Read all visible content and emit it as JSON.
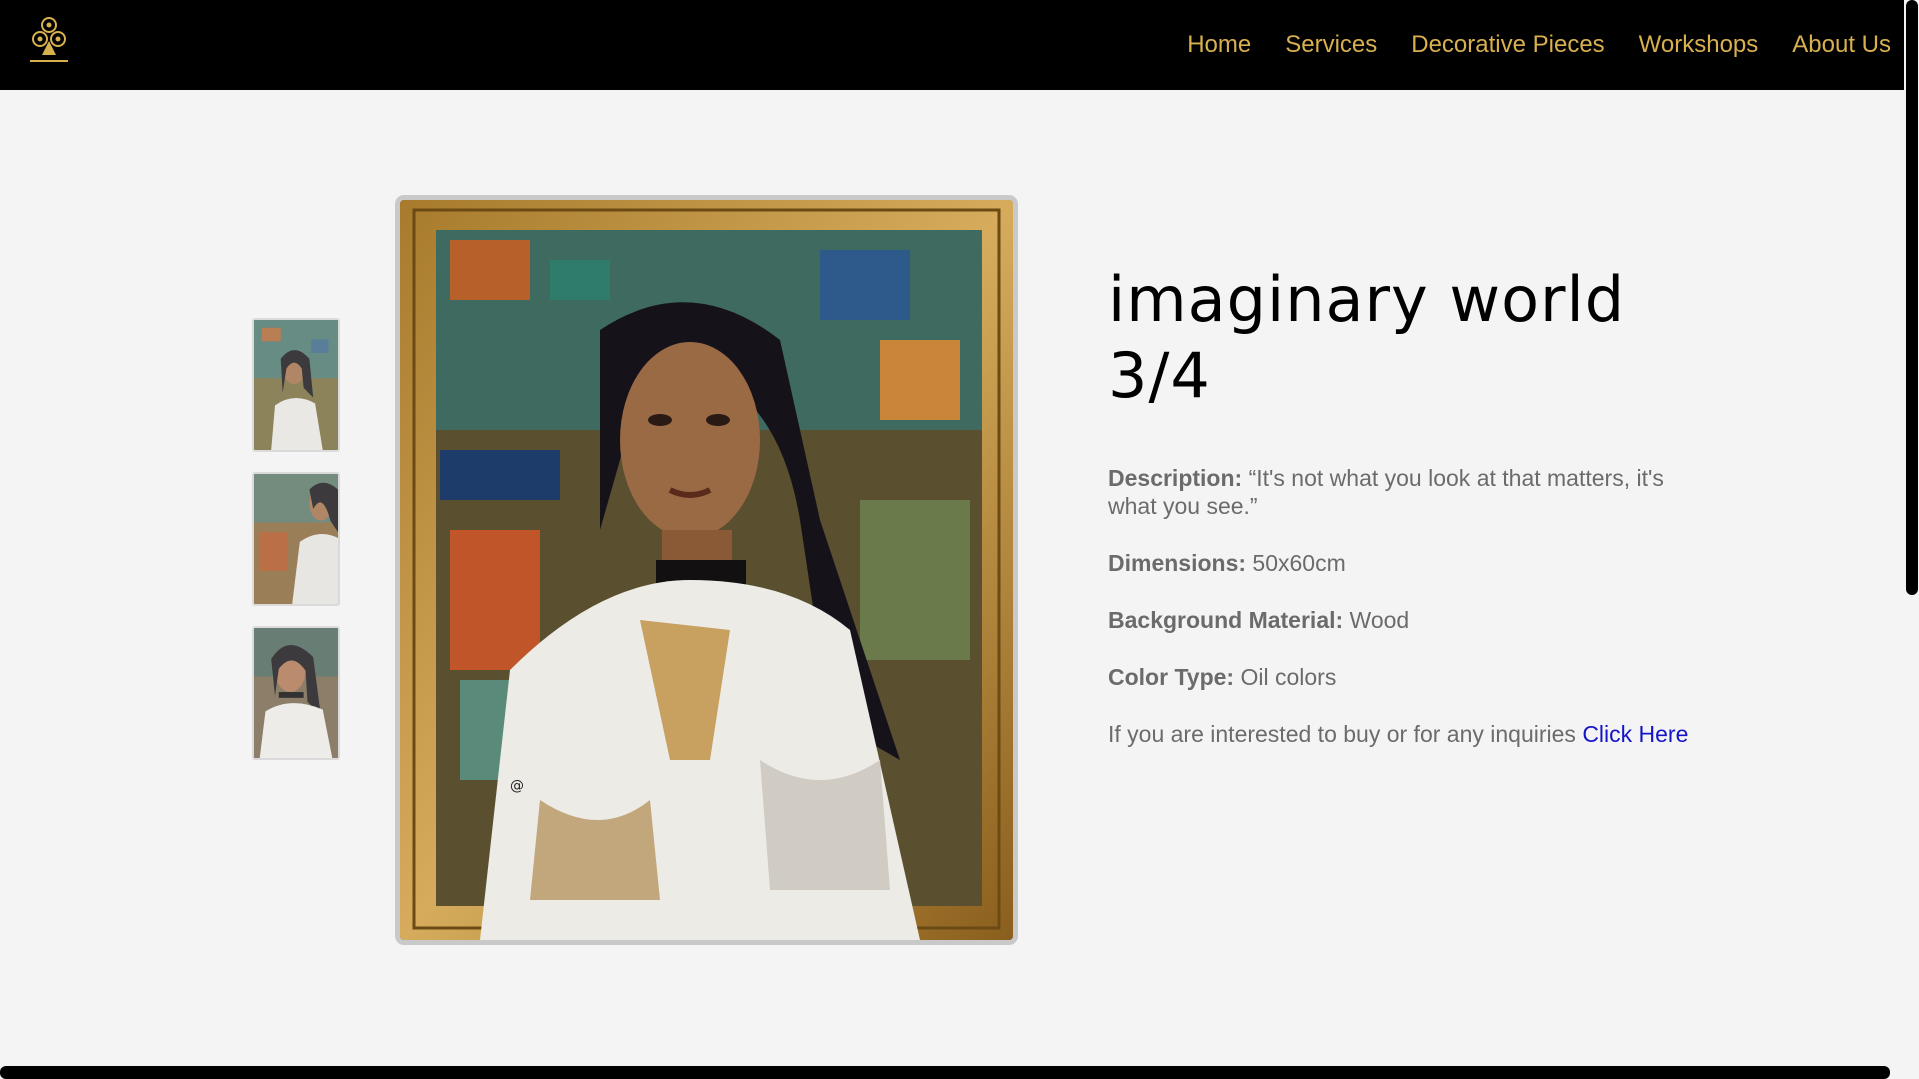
{
  "nav": {
    "logo_alt": "logo",
    "links": [
      "Home",
      "Services",
      "Decorative Pieces",
      "Workshops",
      "About Us"
    ]
  },
  "product": {
    "title": "imaginary world 3/4",
    "description_label": "Description:",
    "description": "“It's not what you look at that matters, it's what you see.”",
    "dimensions_label": "Dimensions:",
    "dimensions": "50x60cm",
    "material_label": "Background Material:",
    "material": "Wood",
    "color_label": "Color Type:",
    "color": "Oil colors",
    "inquiry_text": "If you are interested to buy or for any inquiries ",
    "inquiry_link": "Click Here"
  },
  "gallery": {
    "thumbnails": [
      "painting-thumbnail-1",
      "painting-thumbnail-2",
      "painting-thumbnail-3"
    ],
    "main_image": "portrait-painting"
  },
  "colors": {
    "nav_bg": "#000000",
    "nav_link": "#d8b04e",
    "page_bg": "#f4f4f4",
    "text": "#6b6b6b",
    "link": "#1515c8"
  }
}
